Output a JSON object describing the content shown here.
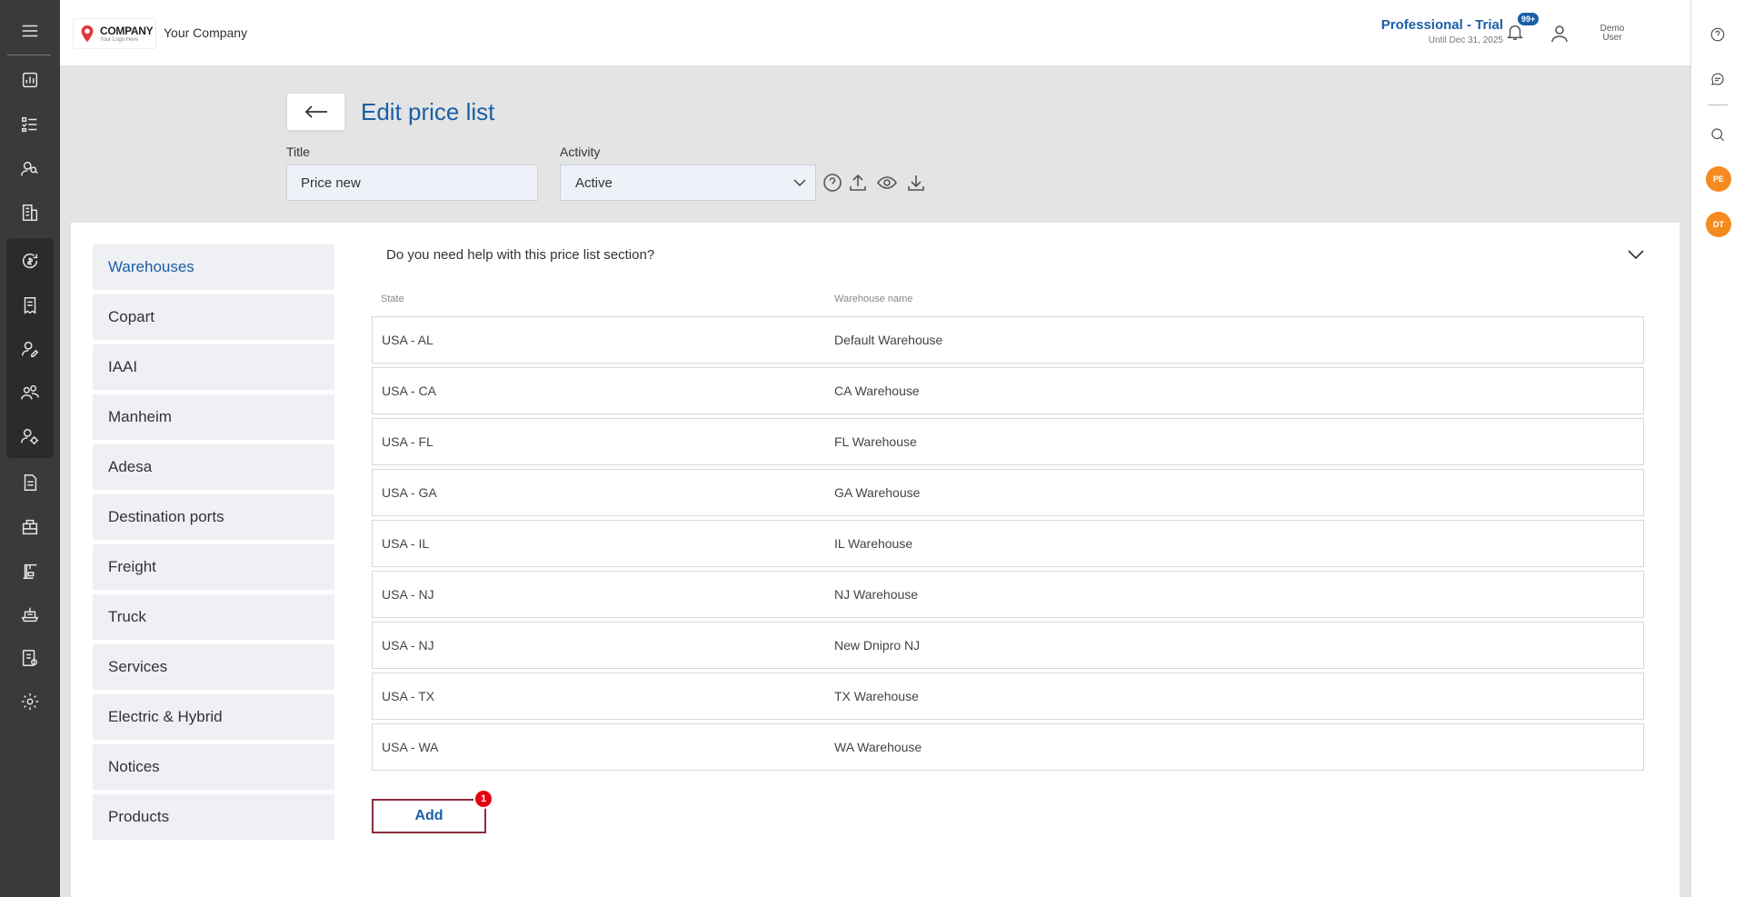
{
  "app": {
    "logo_title": "COMPANY",
    "logo_sub": "Your Logo Here",
    "company_name": "Your Company"
  },
  "plan": {
    "title": "Professional - Trial",
    "until": "Until Dec 31, 2025"
  },
  "notifications": {
    "badge": "99+"
  },
  "user": {
    "first": "Demo",
    "last": "User"
  },
  "right_rail": {
    "avatars": [
      "PE",
      "DT"
    ]
  },
  "page": {
    "title": "Edit price list",
    "title_label": "Title",
    "title_value": "Price new",
    "activity_label": "Activity",
    "activity_value": "Active"
  },
  "sections": [
    "Warehouses",
    "Copart",
    "IAAI",
    "Manheim",
    "Adesa",
    "Destination ports",
    "Freight",
    "Truck",
    "Services",
    "Electric & Hybrid",
    "Notices",
    "Products"
  ],
  "active_section": "Warehouses",
  "help": {
    "text": "Do you need help with this price list section?"
  },
  "table": {
    "headers": {
      "state": "State",
      "name": "Warehouse name"
    },
    "rows": [
      {
        "state": "USA - AL",
        "name": "Default Warehouse"
      },
      {
        "state": "USA - CA",
        "name": "CA Warehouse"
      },
      {
        "state": "USA - FL",
        "name": "FL Warehouse"
      },
      {
        "state": "USA - GA",
        "name": "GA Warehouse"
      },
      {
        "state": "USA - IL",
        "name": "IL Warehouse"
      },
      {
        "state": "USA - NJ",
        "name": "NJ Warehouse"
      },
      {
        "state": "USA - NJ",
        "name": "New Dnipro NJ"
      },
      {
        "state": "USA - TX",
        "name": "TX Warehouse"
      },
      {
        "state": "USA - WA",
        "name": "WA Warehouse"
      }
    ]
  },
  "add_button": {
    "label": "Add",
    "badge": "1"
  },
  "colors": {
    "accent": "#1a5fa6",
    "sidebar": "#3a3a3a",
    "avatar": "#f58b1f",
    "badge": "#e60012"
  }
}
